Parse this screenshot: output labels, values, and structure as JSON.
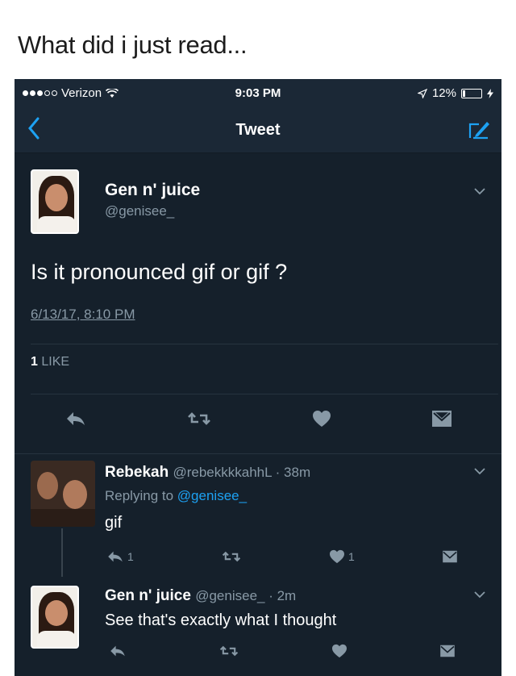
{
  "caption": "What did i just read...",
  "status_bar": {
    "carrier": "Verizon",
    "time": "9:03 PM",
    "battery": "12%"
  },
  "nav": {
    "title": "Tweet",
    "back_icon": "chevron-left-icon",
    "compose_icon": "compose-icon"
  },
  "main_tweet": {
    "name": "Gen n' juice",
    "handle": "@genisee_",
    "text": "Is it pronounced gif or gif ?",
    "date": "6/13/17, 8:10 PM",
    "likes_count": "1",
    "likes_label": "LIKE"
  },
  "replies": [
    {
      "name": "Rebekah",
      "handle_time": "@rebekkkkahhL · 38m",
      "replying_prefix": "Replying to",
      "replying_to": "@genisee_",
      "text": "gif",
      "reply_count": "1",
      "like_count": "1"
    },
    {
      "name": "Gen n' juice",
      "handle_time": "@genisee_ · 2m",
      "text": "See that's exactly what I thought"
    }
  ],
  "colors": {
    "background": "#15202b",
    "accent": "#1da1f2",
    "muted": "#8899a6"
  }
}
